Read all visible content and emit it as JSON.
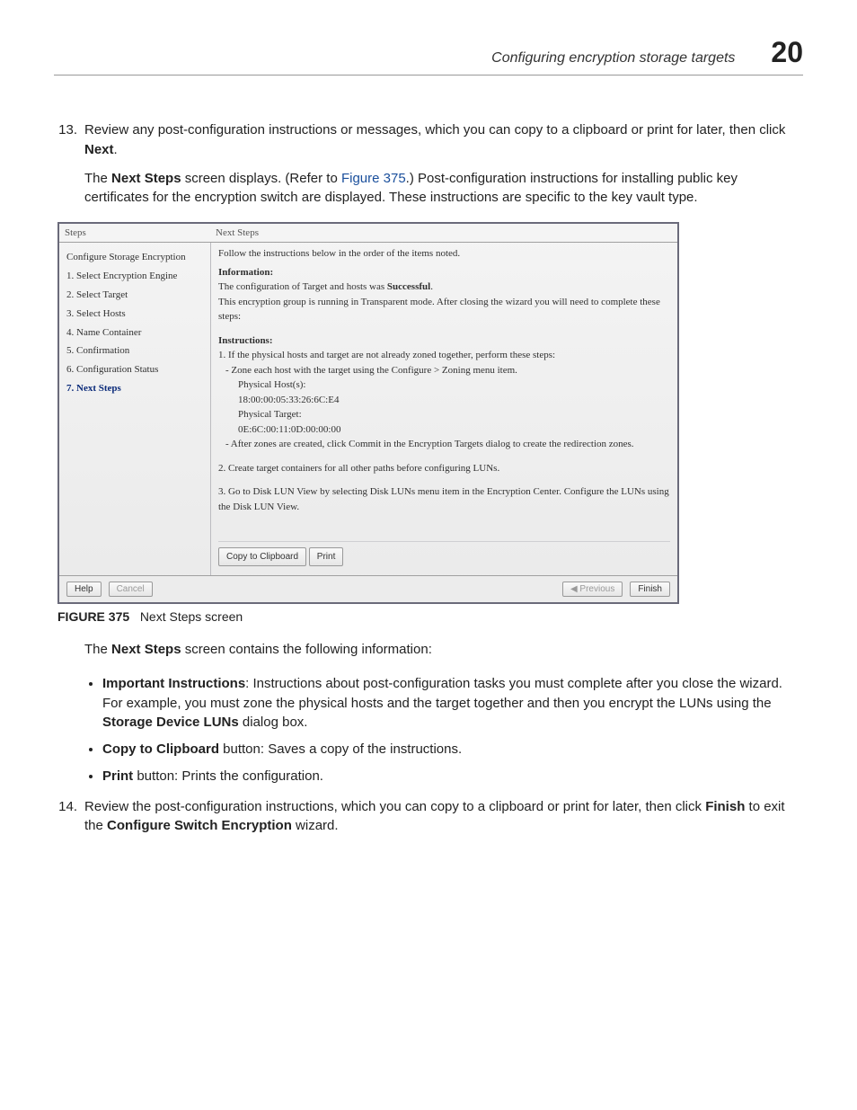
{
  "header": {
    "title": "Configuring encryption storage targets",
    "chapter": "20"
  },
  "item13": {
    "num": "13.",
    "text_a": "Review any post-configuration instructions or messages, which you can copy to a clipboard or print for later, then click ",
    "text_b": "Next",
    "text_c": "."
  },
  "para13b": {
    "a": "The ",
    "b": "Next Steps",
    "c": " screen displays. (Refer to ",
    "d": "Figure 375",
    "e": ".) Post-configuration instructions for installing public key certificates for the encryption switch are displayed. These instructions are specific to the key vault type."
  },
  "dlg": {
    "steps_label": "Steps",
    "panel_title": "Next Steps",
    "left_title": "Configure Storage Encryption",
    "left_items": {
      "s1": "1. Select Encryption Engine",
      "s2": "2. Select Target",
      "s3": "3. Select Hosts",
      "s4": "4. Name Container",
      "s5": "5. Confirmation",
      "s6": "6. Configuration Status",
      "s7": "7. Next Steps"
    },
    "intro": "Follow the instructions below in the order of the items noted.",
    "info_head": "Information:",
    "info_l1a": "The configuration of Target and hosts was ",
    "info_l1b": "Successful",
    "info_l1c": ".",
    "info_l2": "This encryption group is running in Transparent mode. After closing the wizard you will need to complete these steps:",
    "instr_head": "Instructions:",
    "instr1": "1. If the physical hosts and target are not already zoned together, perform these steps:",
    "instr1a": "- Zone each host with the target using the Configure > Zoning menu item.",
    "instr1b": "Physical Host(s):",
    "instr1c": "18:00:00:05:33:26:6C:E4",
    "instr1d": "Physical Target:",
    "instr1e": "0E:6C:00:11:0D:00:00:00",
    "instr1f": "- After zones are created, click Commit in the Encryption Targets dialog to create the redirection zones.",
    "instr2": "2. Create target containers for all other paths before configuring LUNs.",
    "instr3": "3. Go to Disk LUN View by selecting Disk LUNs menu item in the Encryption Center. Configure the LUNs using the Disk LUN View.",
    "btn_copy": "Copy to Clipboard",
    "btn_print": "Print",
    "btn_help": "Help",
    "btn_cancel": "Cancel",
    "btn_prev": "◀ Previous",
    "btn_finish": "Finish"
  },
  "figcap": {
    "label": "FIGURE 375",
    "text": "Next Steps screen"
  },
  "after": {
    "lead_a": "The ",
    "lead_b": "Next Steps",
    "lead_c": " screen contains the following information:"
  },
  "bullets": {
    "b1a": "Important Instructions",
    "b1b": ": Instructions about post-configuration tasks you must complete after you close the wizard. For example, you must zone the physical hosts and the target together and then you encrypt the LUNs using the ",
    "b1c": "Storage Device LUNs",
    "b1d": " dialog box.",
    "b2a": "Copy to Clipboard",
    "b2b": " button: Saves a copy of the instructions.",
    "b3a": "Print",
    "b3b": " button: Prints the configuration."
  },
  "item14": {
    "num": "14.",
    "a": "Review the post-configuration instructions, which you can copy to a clipboard or print for later, then click ",
    "b": "Finish",
    "c": " to exit the ",
    "d": "Configure Switch Encryption",
    "e": " wizard."
  }
}
